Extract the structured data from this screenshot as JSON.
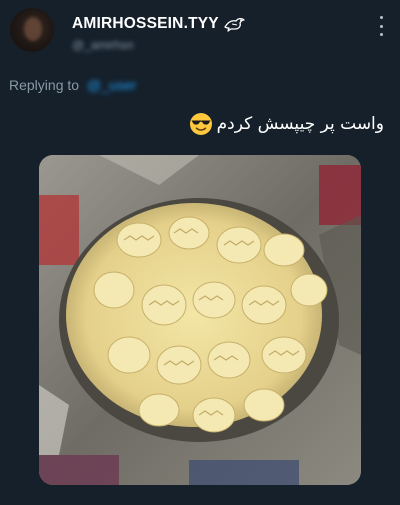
{
  "tweet": {
    "display_name": "AMIRHOSSEIN.TYY",
    "handle": "@_amirhsn",
    "replying_label": "Replying to",
    "replying_handle": "@_user",
    "text": "واست پر چیپسش کردم"
  },
  "icons": {
    "badge": "bird-icon",
    "emoji": "smiling-face-with-sunglasses",
    "more": "more-vertical-icon"
  },
  "colors": {
    "background": "#15202b",
    "secondary_text": "#8899a6",
    "link": "#1d9bf0",
    "emoji_yellow": "#ffc83d"
  }
}
